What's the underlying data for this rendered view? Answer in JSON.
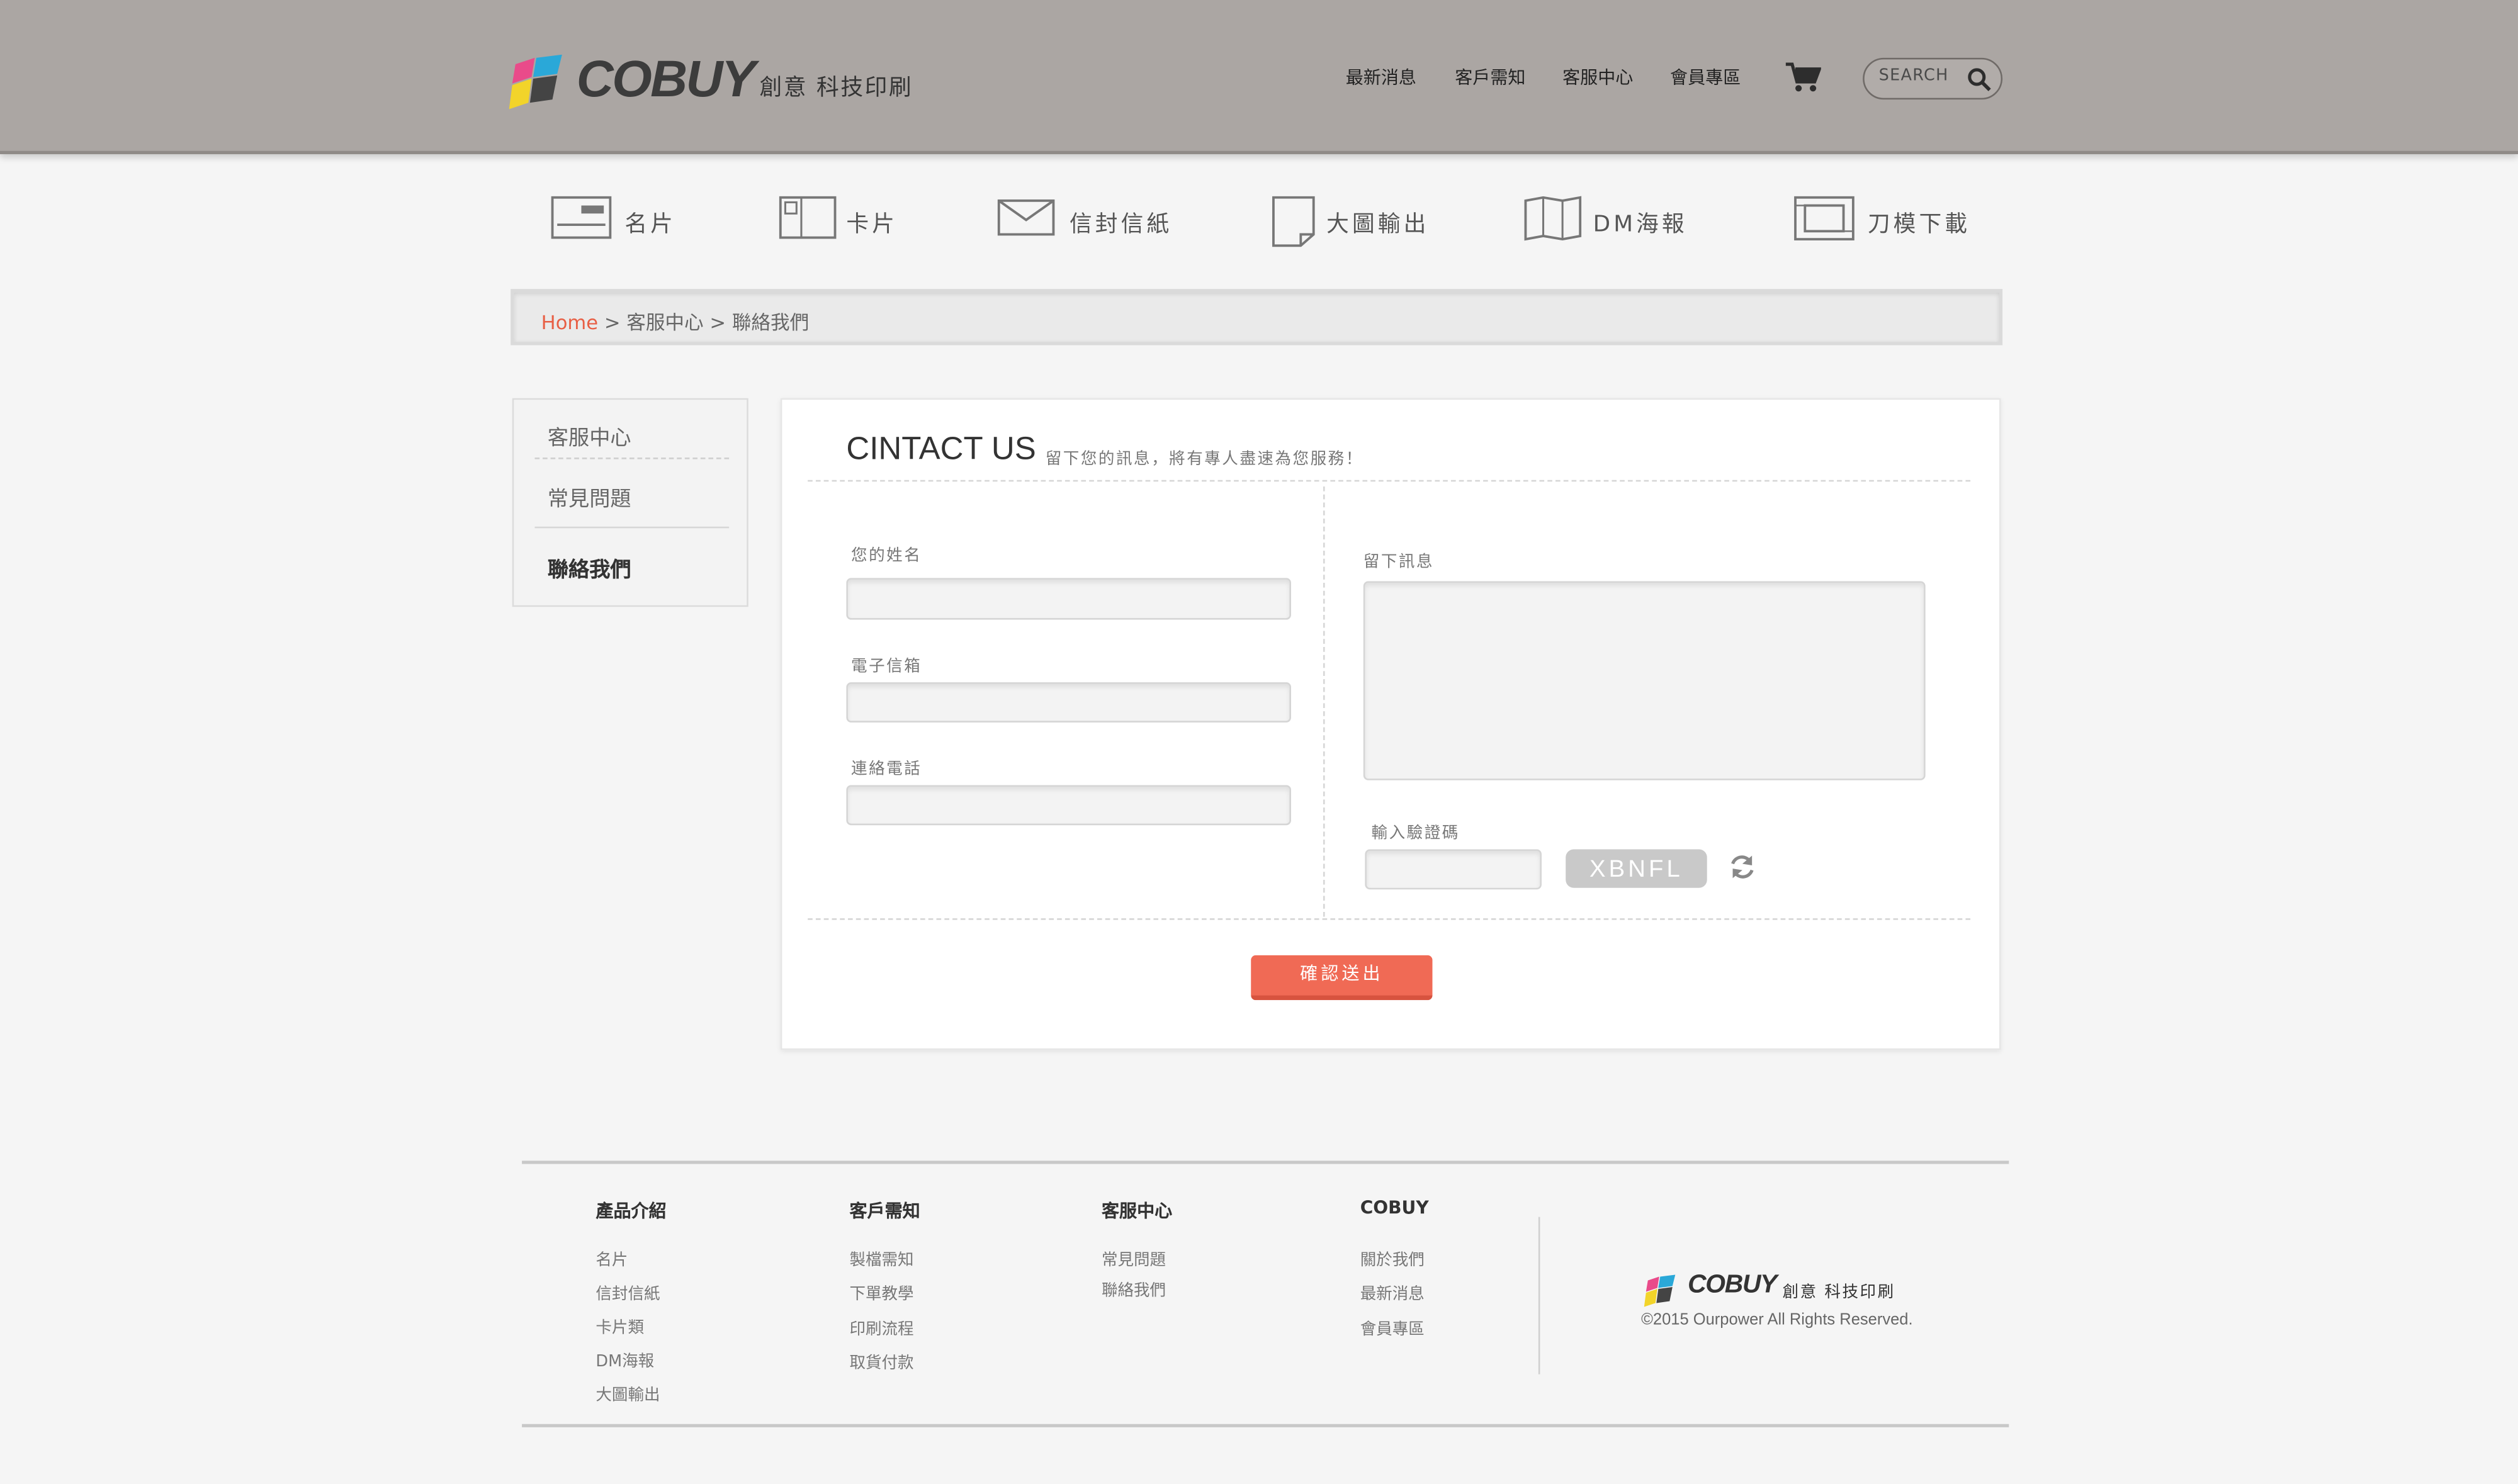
{
  "header": {
    "logo_text": "COBUY",
    "logo_sub": "創意 科技印刷",
    "nav": [
      "最新消息",
      "客戶需知",
      "客服中心",
      "會員專區"
    ],
    "search_placeholder": "SEARCH"
  },
  "categories": [
    "名片",
    "卡片",
    "信封信紙",
    "大圖輸出",
    "DM海報",
    "刀模下載"
  ],
  "breadcrumb": {
    "home": "Home",
    "sep1": " > ",
    "level1": "客服中心",
    "sep2": " > ",
    "level2": "聯絡我們"
  },
  "sidebar": {
    "items": [
      "客服中心",
      "常見問題",
      "聯絡我們"
    ]
  },
  "contact": {
    "title": "CINTACT US",
    "subtitle": "留下您的訊息，將有專人盡速為您服務！",
    "fields": {
      "name_label": "您的姓名",
      "email_label": "電子信箱",
      "phone_label": "連絡電話",
      "message_label": "留下訊息",
      "captcha_label": "輸入驗證碼"
    },
    "captcha_code": "XBNFL",
    "submit_label": "確認送出"
  },
  "footer": {
    "columns": [
      {
        "title": "產品介紹",
        "links": [
          "名片",
          "信封信紙",
          "卡片類",
          "DM海報",
          "大圖輸出"
        ]
      },
      {
        "title": "客戶需知",
        "links": [
          "製檔需知",
          "下單教學",
          "印刷流程",
          "取貨付款"
        ]
      },
      {
        "title": "客服中心",
        "links": [
          "常見問題",
          "聯絡我們"
        ]
      },
      {
        "title": "COBUY",
        "links": [
          "關於我們",
          "最新消息",
          "會員專區"
        ]
      }
    ],
    "logo_text": "COBUY",
    "logo_sub": "創意 科技印刷",
    "copyright": "©2015 Ourpower All Rights Reserved."
  },
  "colors": {
    "accent": "#f06a55",
    "header_bg": "#aba6a3",
    "link_home": "#e85f45"
  }
}
